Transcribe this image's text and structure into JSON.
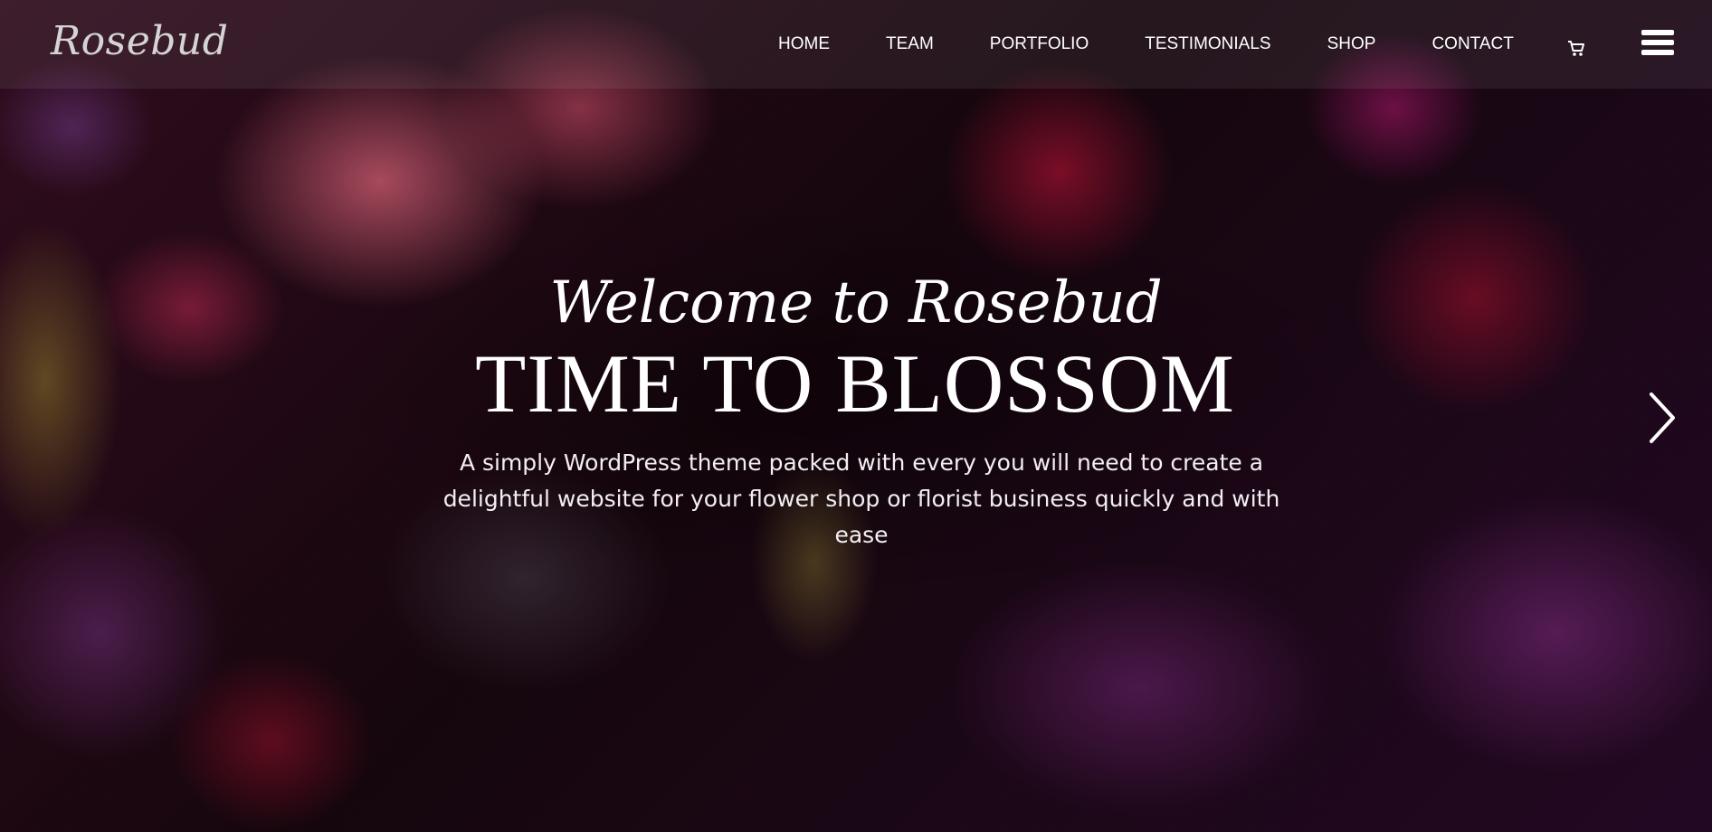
{
  "brand": {
    "logo_text": "Rosebud"
  },
  "nav": {
    "items": [
      {
        "label": "HOME"
      },
      {
        "label": "TEAM"
      },
      {
        "label": "PORTFOLIO"
      },
      {
        "label": "TESTIMONIALS"
      },
      {
        "label": "SHOP"
      },
      {
        "label": "CONTACT"
      }
    ],
    "cart_icon": "cart-icon",
    "menu_icon": "hamburger-menu-icon"
  },
  "hero": {
    "welcome": "Welcome to Rosebud",
    "headline": "TIME TO BLOSSOM",
    "tagline": "A simply WordPress theme packed with every you will need to create a delightful website for your flower shop or florist business quickly and with ease",
    "next_icon": "chevron-right-icon"
  },
  "colors": {
    "text": "#ffffff",
    "overlay_bar": "rgba(255,255,255,0.07)"
  }
}
